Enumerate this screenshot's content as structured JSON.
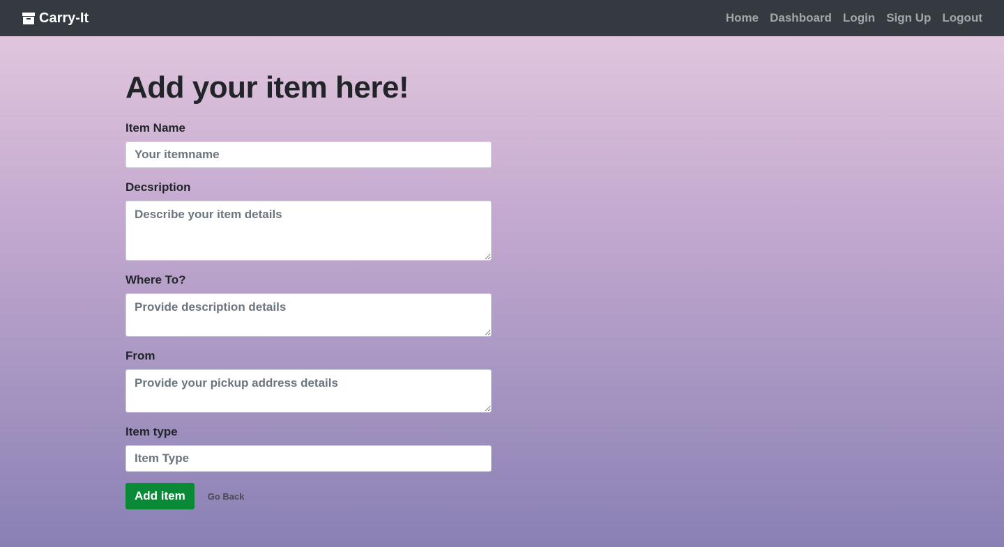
{
  "nav": {
    "brand": "Carry-It",
    "brand_icon": "archive-box-icon",
    "links": [
      "Home",
      "Dashboard",
      "Login",
      "Sign Up",
      "Logout"
    ]
  },
  "page": {
    "title": "Add your item here!"
  },
  "form": {
    "item_name": {
      "label": "Item Name",
      "placeholder": "Your itemname",
      "value": ""
    },
    "description": {
      "label": "Decsription",
      "placeholder": "Describe your item details",
      "value": ""
    },
    "where_to": {
      "label": "Where To?",
      "placeholder": "Provide description details",
      "value": ""
    },
    "from": {
      "label": "From",
      "placeholder": "Provide your pickup address details",
      "value": ""
    },
    "item_type": {
      "label": "Item type",
      "placeholder": "Item Type",
      "value": ""
    },
    "submit_label": "Add item",
    "back_label": "Go Back"
  },
  "colors": {
    "navbar": "#343a40",
    "submit_button": "#0a8a36",
    "gradient_top": "#e7cbe0",
    "gradient_bottom": "#8a80b4"
  }
}
